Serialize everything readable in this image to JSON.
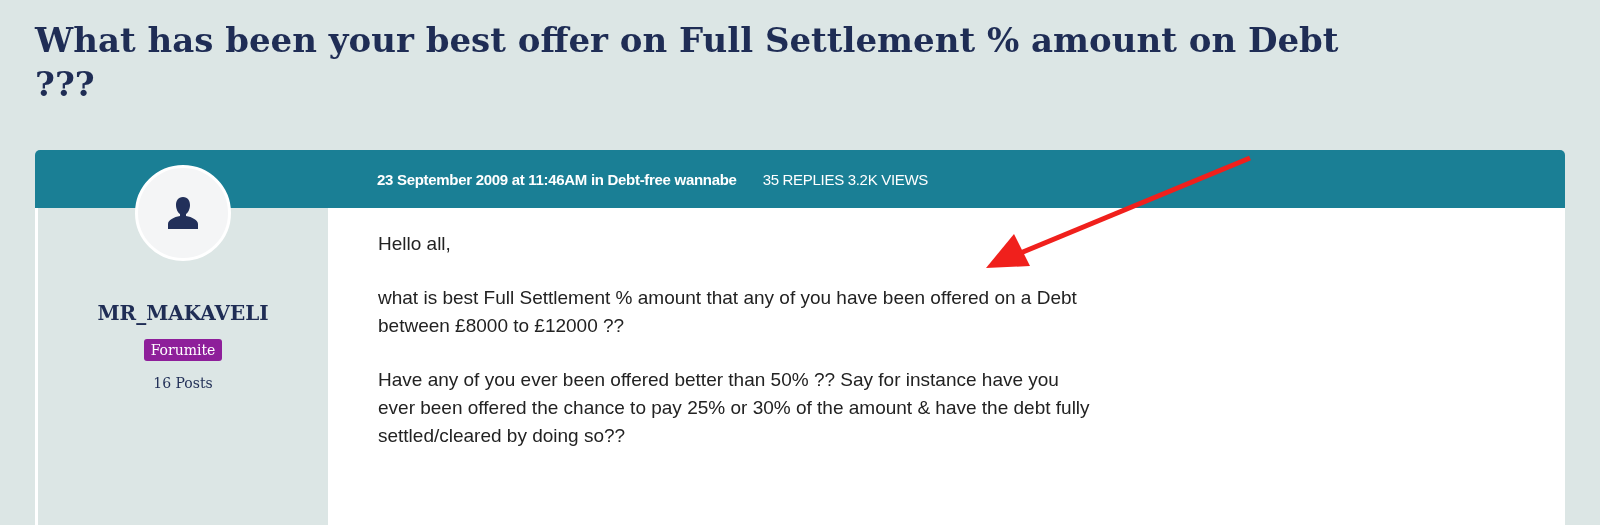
{
  "thread_title": "What has been your best offer on Full Settlement % amount on Debt ???",
  "post": {
    "meta": "23 September 2009 at 11:46AM in Debt-free wannabe",
    "stats": "35 REPLIES 3.2K VIEWS",
    "author": {
      "name": "MR_MAKAVELI",
      "rank": "Forumite",
      "posts": "16 Posts"
    },
    "paragraphs": [
      "Hello all,",
      "what is best Full Settlement % amount that any of you have been offered on a Debt between £8000 to £12000 ??",
      "Have any of you ever been offered better than 50% ?? Say for instance have you ever been offered the chance to pay 25% or 30% of the amount & have the debt fully settled/cleared by doing so??"
    ]
  }
}
